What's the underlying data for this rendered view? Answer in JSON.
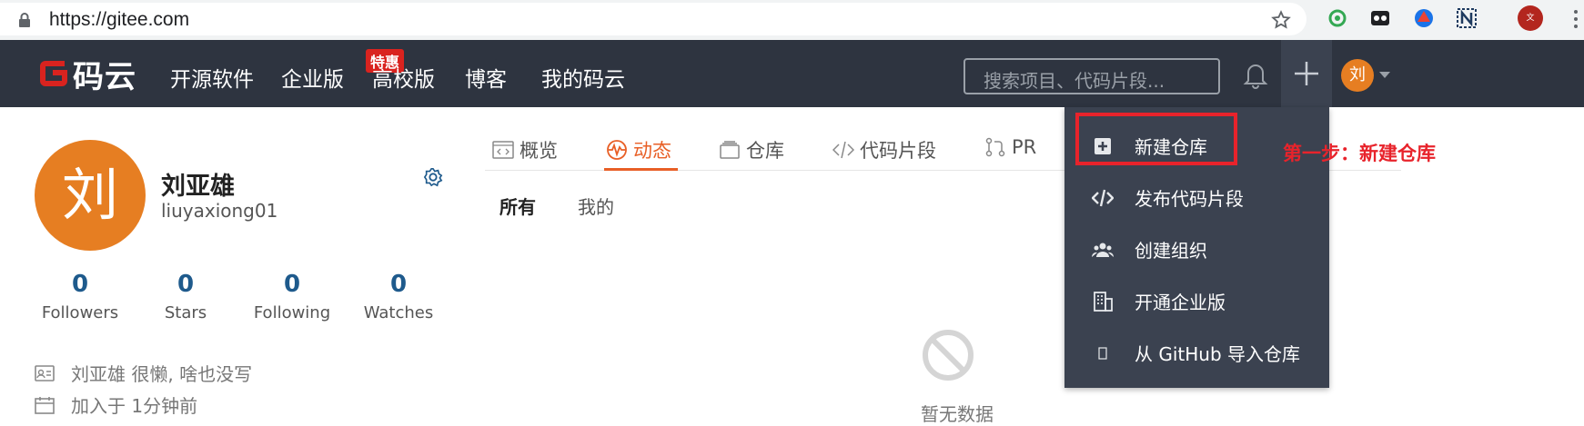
{
  "browser": {
    "url": "https://gitee.com",
    "profile_initial": "文"
  },
  "navbar": {
    "logo_text": "码云",
    "items": [
      "开源软件",
      "企业版",
      "高校版",
      "博客",
      "我的码云"
    ],
    "badge": "特惠",
    "search_placeholder": "搜索项目、代码片段...",
    "user_initial": "刘"
  },
  "profile": {
    "avatar_initial": "刘",
    "name": "刘亚雄",
    "username": "liuyaxiong01",
    "stats": [
      {
        "value": "0",
        "label": "Followers"
      },
      {
        "value": "0",
        "label": "Stars"
      },
      {
        "value": "0",
        "label": "Following"
      },
      {
        "value": "0",
        "label": "Watches"
      }
    ],
    "bio": "刘亚雄 很懒, 啥也没写",
    "joined": "加入于 1分钟前"
  },
  "tabs": {
    "items": [
      "概览",
      "动态",
      "仓库",
      "代码片段",
      "PR"
    ],
    "active": "动态",
    "subtabs": [
      "所有",
      "我的"
    ],
    "empty_text": "暂无数据"
  },
  "dropdown": {
    "items": [
      "新建仓库",
      "发布代码片段",
      "创建组织",
      "开通企业版",
      "从 GitHub 导入仓库"
    ]
  },
  "annotation": "第一步：新建仓库",
  "colors": {
    "navbar": "#2e3440",
    "brand_red": "#d9231f",
    "accent_orange": "#e85f26",
    "avatar_orange": "#e67e22",
    "annotation_red": "#e8232b"
  }
}
